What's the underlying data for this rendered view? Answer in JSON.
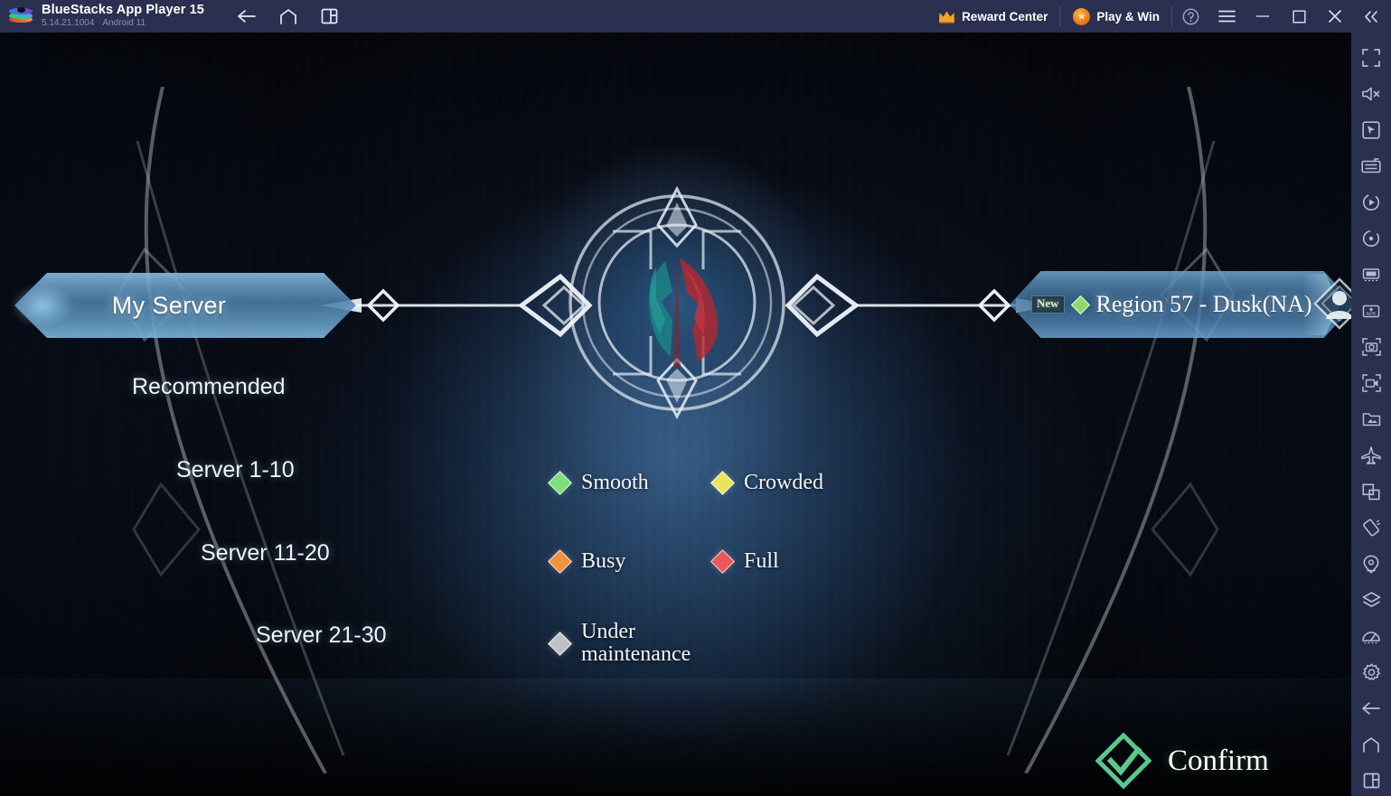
{
  "titlebar": {
    "app_name": "BlueStacks App Player 15",
    "version": "5.14.21.1004",
    "android_version": "Android 11",
    "logo_icon": "bluestacks-logo",
    "nav": [
      {
        "icon": "back-arrow-icon",
        "name": "back"
      },
      {
        "icon": "home-icon",
        "name": "home"
      },
      {
        "icon": "multi-instance-icon",
        "name": "instance-manager"
      }
    ],
    "reward_center": {
      "label": "Reward Center",
      "icon": "crown-icon"
    },
    "play_and_win": {
      "label": "Play & Win",
      "icon": "orange-badge-icon"
    },
    "help_icon": "help-circle-icon",
    "menu_icon": "hamburger-menu-icon",
    "minimize_icon": "minimize-icon",
    "maximize_icon": "maximize-icon",
    "close_icon": "close-icon",
    "collapse_icon": "double-chevron-left-icon"
  },
  "sidebar": {
    "items": [
      {
        "icon": "fullscreen-icon",
        "name": "fullscreen"
      },
      {
        "icon": "mute-speaker-icon",
        "name": "mute"
      },
      {
        "icon": "cursor-pointer-icon",
        "name": "game-controls"
      },
      {
        "icon": "keyboard-icon",
        "name": "keymapping"
      },
      {
        "icon": "macro-play-icon",
        "name": "macro-recorder"
      },
      {
        "icon": "rotate-icon",
        "name": "rotate"
      },
      {
        "icon": "eco-mode-icon",
        "name": "eco-mode"
      },
      {
        "icon": "apk-install-icon",
        "name": "install-apk"
      },
      {
        "icon": "screenshot-icon",
        "name": "screenshot"
      },
      {
        "icon": "record-video-icon",
        "name": "record-screen"
      },
      {
        "icon": "media-manager-icon",
        "name": "media-manager"
      },
      {
        "icon": "airplane-mode-icon",
        "name": "airplane-mode"
      },
      {
        "icon": "multi-window-icon",
        "name": "multi-window"
      },
      {
        "icon": "shake-icon",
        "name": "shake"
      },
      {
        "icon": "location-pin-icon",
        "name": "location"
      },
      {
        "icon": "layers-icon",
        "name": "layers"
      },
      {
        "icon": "performance-gauge-icon",
        "name": "performance"
      },
      {
        "icon": "gear-icon",
        "name": "settings"
      },
      {
        "icon": "back-arrow-icon",
        "name": "back"
      },
      {
        "icon": "home-icon",
        "name": "home"
      },
      {
        "icon": "recents-icon",
        "name": "recent-apps"
      }
    ]
  },
  "game": {
    "my_server_tab": {
      "label": "My Server"
    },
    "selected_server": {
      "badge": "New",
      "status_icon": "green-diamond",
      "status_color": "#8fd96a",
      "name": "Region 57 - Dusk(NA)",
      "avatar_icon": "player-avatar-icon"
    },
    "emblem_icon": "ornate-circular-emblem",
    "nav_items": [
      {
        "label": "Recommended"
      },
      {
        "label": "Server 1-10"
      },
      {
        "label": "Server 11-20"
      },
      {
        "label": "Server 21-30"
      }
    ],
    "legend": [
      {
        "label": "Smooth",
        "color": "#7ee07a",
        "icon": "green-diamond"
      },
      {
        "label": "Crowded",
        "color": "#e8e45e",
        "icon": "yellow-diamond"
      },
      {
        "label": "Busy",
        "color": "#f0913e",
        "icon": "orange-diamond"
      },
      {
        "label": "Full",
        "color": "#e85a5a",
        "icon": "red-diamond"
      },
      {
        "label": "Under\nmaintenance",
        "color": "#bcc2c6",
        "icon": "gray-diamond"
      }
    ],
    "confirm_button": {
      "label": "Confirm",
      "icon": "green-check-diamond-icon",
      "color": "#57c98f"
    }
  }
}
